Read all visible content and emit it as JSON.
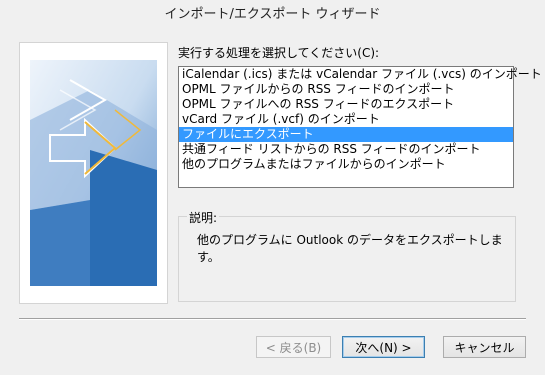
{
  "window": {
    "title": "インポート/エクスポート ウィザード"
  },
  "instruction": "実行する処理を選択してください(C):",
  "actions": [
    {
      "label": "iCalendar (.ics) または vCalendar ファイル (.vcs) のインポート",
      "selected": false
    },
    {
      "label": "OPML ファイルからの RSS フィードのインポート",
      "selected": false
    },
    {
      "label": "OPML ファイルへの RSS フィードのエクスポート",
      "selected": false
    },
    {
      "label": "vCard ファイル (.vcf) のインポート",
      "selected": false
    },
    {
      "label": "ファイルにエクスポート",
      "selected": true
    },
    {
      "label": "共通フィード リストからの RSS フィードのインポート",
      "selected": false
    },
    {
      "label": "他のプログラムまたはファイルからのインポート",
      "selected": false
    }
  ],
  "description": {
    "label": "説明:",
    "text": "他のプログラムに Outlook のデータをエクスポートします。"
  },
  "buttons": {
    "back": "< 戻る(B)",
    "next": "次へ(N) >",
    "cancel": "キャンセル"
  },
  "colors": {
    "selection": "#3399ff",
    "graphic_blue": "#2a6db4",
    "graphic_light": "#c9dcf0",
    "arrow_orange": "#f0b93a"
  }
}
